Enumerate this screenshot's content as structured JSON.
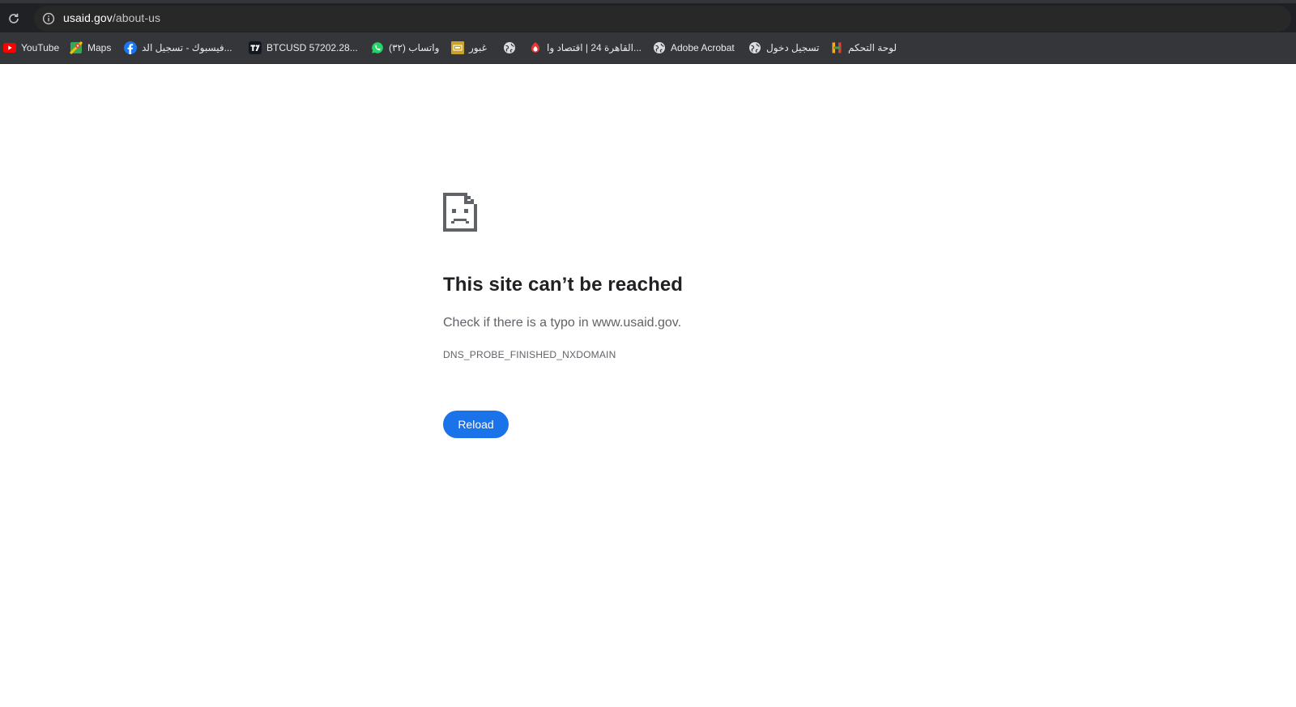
{
  "address_bar": {
    "host": "usaid.gov",
    "path": "/about-us"
  },
  "bookmarks": [
    {
      "label": "YouTube",
      "icon": "youtube-icon"
    },
    {
      "label": "Maps",
      "icon": "maps-icon"
    },
    {
      "label": "فيسبوك - تسجيل الد...",
      "icon": "facebook-icon"
    },
    {
      "label": "BTCUSD 57202.28...",
      "icon": "tradingview-icon"
    },
    {
      "label": "(٣٢) واتساب",
      "icon": "whatsapp-icon"
    },
    {
      "label": "غبور",
      "icon": "ghabbour-icon"
    },
    {
      "label": "",
      "icon": "globe-icon"
    },
    {
      "label": "القاهرة 24 | اقتصاد وا...",
      "icon": "cairo24-icon"
    },
    {
      "label": "Adobe Acrobat",
      "icon": "globe-icon"
    },
    {
      "label": "تسجيل دخول",
      "icon": "globe-icon"
    },
    {
      "label": "لوحة التحكم",
      "icon": "hostinger-icon"
    }
  ],
  "error_page": {
    "title": "This site can’t be reached",
    "message": "Check if there is a typo in www.usaid.gov.",
    "error_code": "DNS_PROBE_FINISHED_NXDOMAIN",
    "reload_label": "Reload"
  },
  "colors": {
    "toolbar_bg": "#202124",
    "bookmarks_bg": "#35363a",
    "accent": "#1a73e8",
    "youtube": "#ff0000",
    "facebook": "#1877f2",
    "whatsapp": "#25d366"
  }
}
